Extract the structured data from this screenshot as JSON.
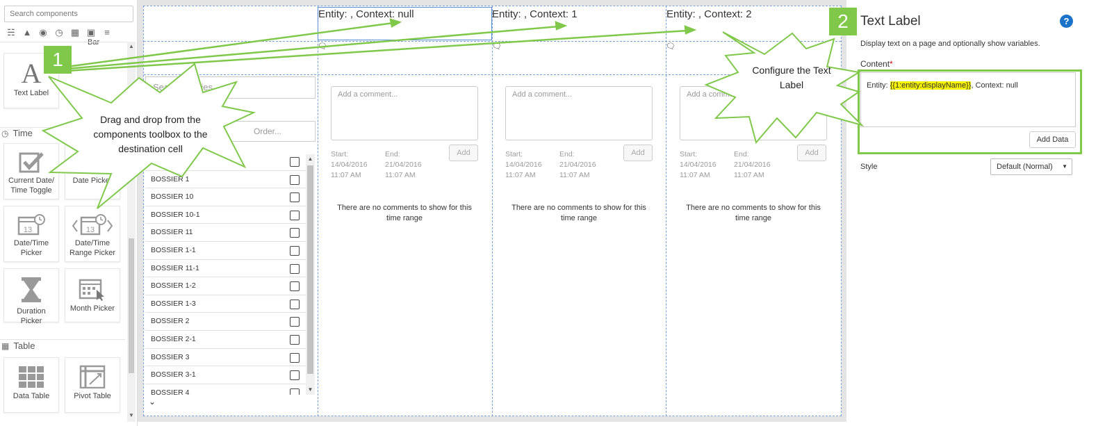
{
  "toolbox": {
    "search_placeholder": "Search components",
    "partial_label": "Bar",
    "tiles": [
      {
        "label": "Text Label",
        "icon": "text-label-icon"
      },
      {
        "label": "Current Date/ Time Toggle",
        "icon": "checkbox-toggle-icon"
      },
      {
        "label": "Date Picker",
        "icon": "calendar-icon"
      },
      {
        "label": "Date/Time Picker",
        "icon": "calendar-clock-icon"
      },
      {
        "label": "Date/Time Range Picker",
        "icon": "calendar-range-icon"
      },
      {
        "label": "Duration Picker",
        "icon": "hourglass-icon"
      },
      {
        "label": "Month Picker",
        "icon": "calendar-cursor-icon"
      },
      {
        "label": "Data Table",
        "icon": "grid-table-icon"
      },
      {
        "label": "Pivot Table",
        "icon": "pivot-table-icon"
      }
    ],
    "sections": {
      "time": "Time",
      "table": "Table"
    }
  },
  "canvas": {
    "entity_labels": [
      "Entity: , Context: null",
      "Entity: , Context: 1",
      "Entity: , Context: 2"
    ],
    "search_placeholder": "Search entities...",
    "order_placeholder": "Order...",
    "list_items": [
      "BOSSIER 1",
      "BOSSIER 10",
      "BOSSIER 10-1",
      "BOSSIER 11",
      "BOSSIER 1-1",
      "BOSSIER 11-1",
      "BOSSIER 1-2",
      "BOSSIER 1-3",
      "BOSSIER 2",
      "BOSSIER 2-1",
      "BOSSIER 3",
      "BOSSIER 3-1",
      "BOSSIER 4"
    ],
    "comment_placeholder": "Add a comment...",
    "add_label": "Add",
    "start_label": "Start:",
    "end_label": "End:",
    "start_date": "14/04/2016",
    "end_date": "21/04/2016",
    "time": "11:07 AM",
    "no_comments": "There are no comments to show for this time range"
  },
  "properties": {
    "title": "Text Label",
    "description": "Display text on a page and optionally show variables.",
    "content_label": "Content",
    "required_mark": "*",
    "content_prefix": "Entity: ",
    "content_token": "{{1:entity:displayName}}",
    "content_suffix": ", Context: null",
    "add_data_label": "Add Data",
    "style_label": "Style",
    "style_value": "Default (Normal)"
  },
  "callouts": {
    "badge1": "1",
    "badge2": "2",
    "burst1_text": "Drag and drop from the components toolbox to the destination cell",
    "burst2_text": "Configure the Text Label"
  },
  "colors": {
    "accent_green": "#7fc84a",
    "help_blue": "#1a73c8",
    "guide_blue": "#7aa0d8",
    "highlight": "#f6f200"
  }
}
